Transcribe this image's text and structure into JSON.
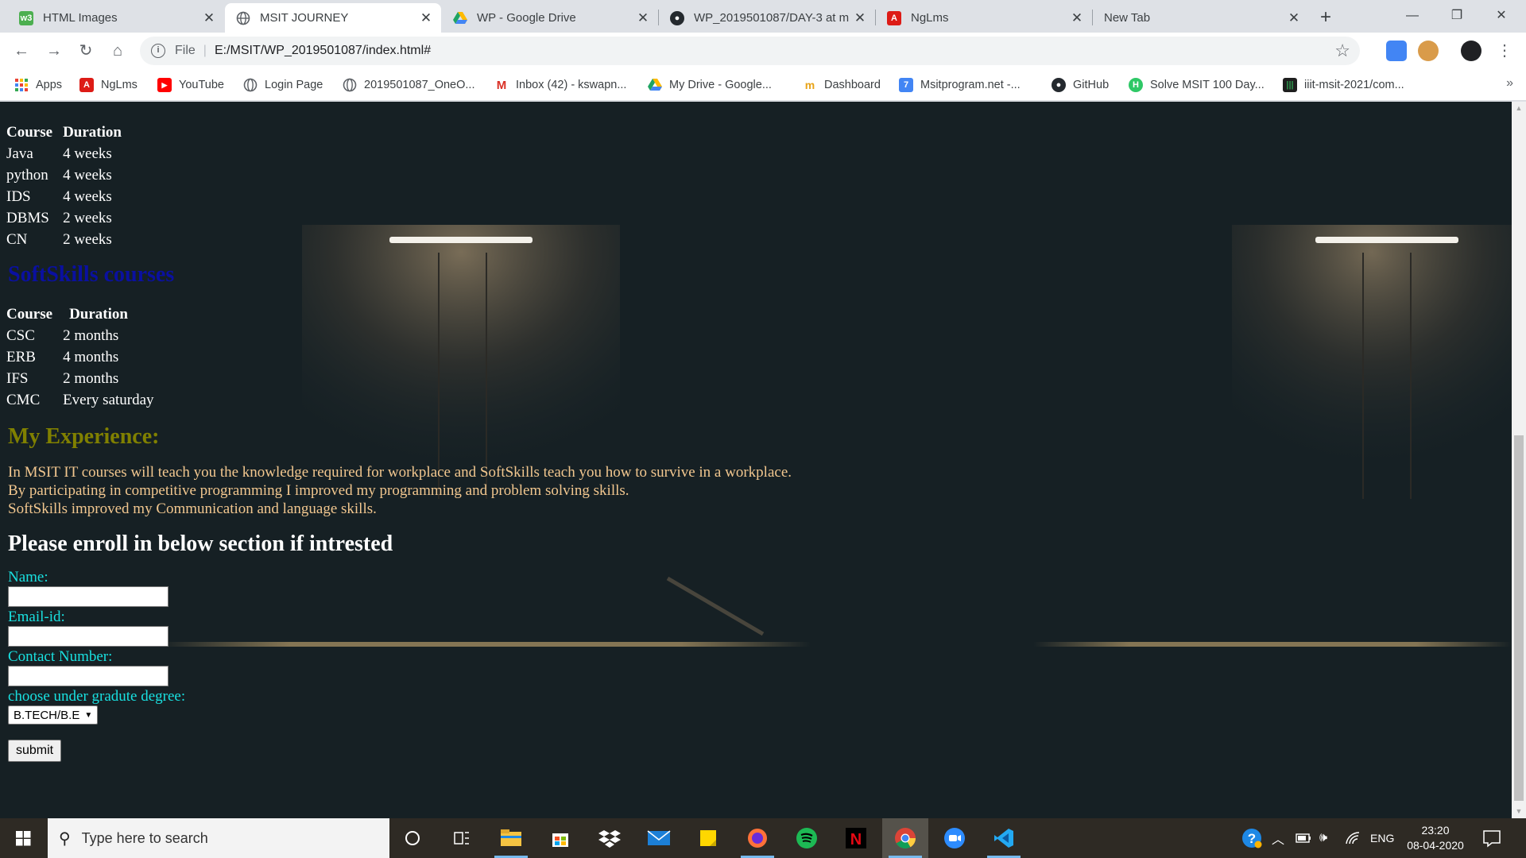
{
  "browser": {
    "tabs": [
      {
        "title": "HTML Images",
        "favicon": "w3schools-icon",
        "color": "#4caf50"
      },
      {
        "title": "MSIT JOURNEY",
        "favicon": "globe-icon",
        "color": "#5f6368",
        "active": true
      },
      {
        "title": "WP - Google Drive",
        "favicon": "google-drive-icon",
        "color": "#1fa463"
      },
      {
        "title": "WP_2019501087/DAY-3 at m",
        "favicon": "github-icon",
        "color": "#24292e"
      },
      {
        "title": "NgLms",
        "favicon": "angular-icon",
        "color": "#dd1b16"
      },
      {
        "title": "New Tab",
        "favicon": "",
        "color": ""
      }
    ],
    "new_tab_label": "+",
    "url_scheme": "File",
    "url": "E:/MSIT/WP_2019501087/index.html#",
    "bookmarks": [
      {
        "label": "Apps",
        "icon": "apps-grid-icon",
        "color": "#ea4335"
      },
      {
        "label": "NgLms",
        "icon": "angular-icon",
        "color": "#dd1b16"
      },
      {
        "label": "YouTube",
        "icon": "youtube-icon",
        "color": "#ff0000"
      },
      {
        "label": "Login Page",
        "icon": "globe-icon",
        "color": "#5f6368"
      },
      {
        "label": "2019501087_OneO...",
        "icon": "globe-icon",
        "color": "#5f6368"
      },
      {
        "label": "Inbox (42) - kswapn...",
        "icon": "gmail-icon",
        "color": "#d93025"
      },
      {
        "label": "My Drive - Google...",
        "icon": "google-drive-icon",
        "color": "#1fa463"
      },
      {
        "label": "Dashboard",
        "icon": "dashboard-icon",
        "color": "#e8a317"
      },
      {
        "label": "Msitprogram.net -...",
        "icon": "calendar-icon",
        "color": "#4285f4"
      },
      {
        "label": "GitHub",
        "icon": "github-icon",
        "color": "#24292e"
      },
      {
        "label": "Solve MSIT 100 Day...",
        "icon": "hackerrank-icon",
        "color": "#2ec866"
      },
      {
        "label": "iiit-msit-2021/com...",
        "icon": "repo-icon",
        "color": "#2f9c4e"
      }
    ],
    "bookmarks_more": "»"
  },
  "page": {
    "it_table": {
      "headers": [
        "Course",
        "Duration"
      ],
      "rows": [
        [
          "Java",
          "4 weeks"
        ],
        [
          "python",
          "4 weeks"
        ],
        [
          "IDS",
          "4 weeks"
        ],
        [
          "DBMS",
          "2 weeks"
        ],
        [
          "CN",
          "2 weeks"
        ]
      ]
    },
    "softskills_heading": "SoftSkills courses",
    "softskills_table": {
      "headers": [
        "Course",
        "Duration"
      ],
      "rows": [
        [
          "CSC",
          "2 months"
        ],
        [
          "ERB",
          "4 months"
        ],
        [
          "IFS",
          "2 months"
        ],
        [
          "CMC",
          "Every saturday"
        ]
      ]
    },
    "experience_heading": "My Experience:",
    "experience_lines": [
      "In MSIT IT courses will teach you the knowledge required for workplace and SoftSkills teach you how to survive in a workplace.",
      "By participating in competitive programming I improved my programming and problem solving skills.",
      "SoftSkills improved my Communication and language skills."
    ],
    "enroll_heading": "Please enroll in below section if intrested",
    "form": {
      "name_label": "Name:",
      "email_label": "Email-id:",
      "contact_label": "Contact Number:",
      "degree_label": "choose under gradute degree:",
      "degree_selected": "B.TECH/B.E",
      "submit_label": "submit"
    }
  },
  "taskbar": {
    "search_placeholder": "Type here to search",
    "apps": [
      "cortana-icon",
      "task-view-icon",
      "file-explorer-icon",
      "store-icon",
      "dropbox-icon",
      "mail-icon",
      "sticky-notes-icon",
      "firefox-icon",
      "spotify-icon",
      "netflix-icon",
      "chrome-icon",
      "zoom-icon",
      "vscode-icon"
    ],
    "language": "ENG",
    "time": "23:20",
    "date": "08-04-2020"
  }
}
